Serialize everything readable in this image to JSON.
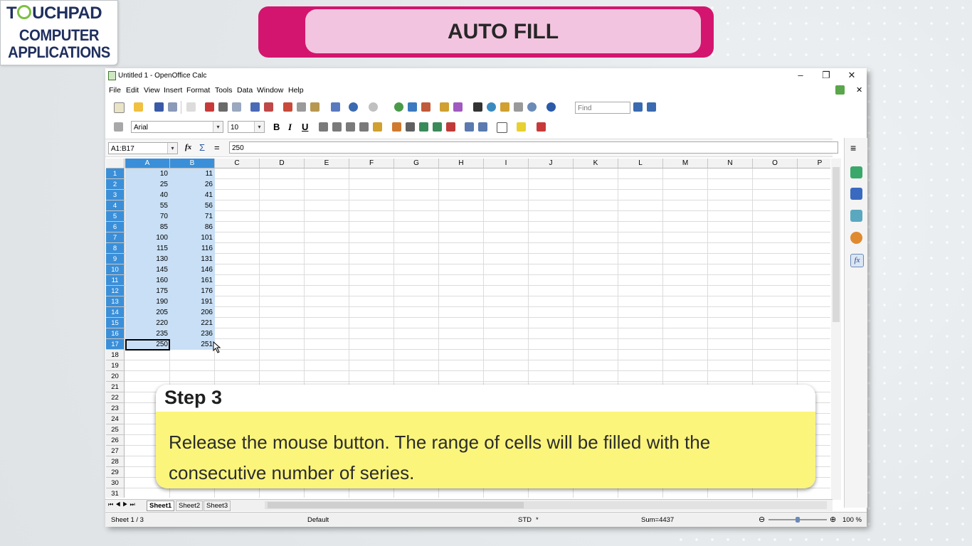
{
  "brand": {
    "logo_line1_pre": "T",
    "logo_line1_post": "UCHPAD",
    "logo_line2": "COMPUTER",
    "logo_line3": "APPLICATIONS"
  },
  "banner": {
    "title": "AUTO FILL"
  },
  "window": {
    "title": "Untitled 1 - OpenOffice Calc",
    "minimize": "–",
    "restore": "❐",
    "close": "✕",
    "doc_close": "✕"
  },
  "menu": [
    "File",
    "Edit",
    "View",
    "Insert",
    "Format",
    "Tools",
    "Data",
    "Window",
    "Help"
  ],
  "toolbar": {
    "find_placeholder": "Find",
    "font_name": "Arial",
    "font_size": "10",
    "bold": "B",
    "italic": "I",
    "underline": "U"
  },
  "formula_bar": {
    "name_box": "A1:B17",
    "fx": "fx",
    "sum": "Σ",
    "equals": "=",
    "content": "250"
  },
  "columns": [
    "A",
    "B",
    "C",
    "D",
    "E",
    "F",
    "G",
    "H",
    "I",
    "J",
    "K",
    "L",
    "M",
    "N",
    "O",
    "P"
  ],
  "rows": [
    "1",
    "2",
    "3",
    "4",
    "5",
    "6",
    "7",
    "8",
    "9",
    "10",
    "11",
    "12",
    "13",
    "14",
    "15",
    "16",
    "17",
    "18",
    "19",
    "20",
    "21",
    "22",
    "23",
    "24",
    "25",
    "26",
    "27",
    "28",
    "29",
    "30",
    "31"
  ],
  "cells": {
    "colA": [
      "10",
      "25",
      "40",
      "55",
      "70",
      "85",
      "100",
      "115",
      "130",
      "145",
      "160",
      "175",
      "190",
      "205",
      "220",
      "235",
      "250"
    ],
    "colB": [
      "11",
      "26",
      "41",
      "56",
      "71",
      "86",
      "101",
      "116",
      "131",
      "146",
      "161",
      "176",
      "191",
      "206",
      "221",
      "236",
      "251"
    ]
  },
  "sheet_tabs": [
    "Sheet1",
    "Sheet2",
    "Sheet3"
  ],
  "status": {
    "sheet": "Sheet 1 / 3",
    "style": "Default",
    "mode": "STD",
    "modified": "*",
    "sum": "Sum=4437",
    "zoom": "100 %",
    "zoom_minus": "⊖",
    "zoom_plus": "⊕",
    "zoom_level": 0.5
  },
  "callout": {
    "step": "Step 3",
    "text": "Release the mouse button. The range of cells will be filled with the consecutive number of series."
  }
}
